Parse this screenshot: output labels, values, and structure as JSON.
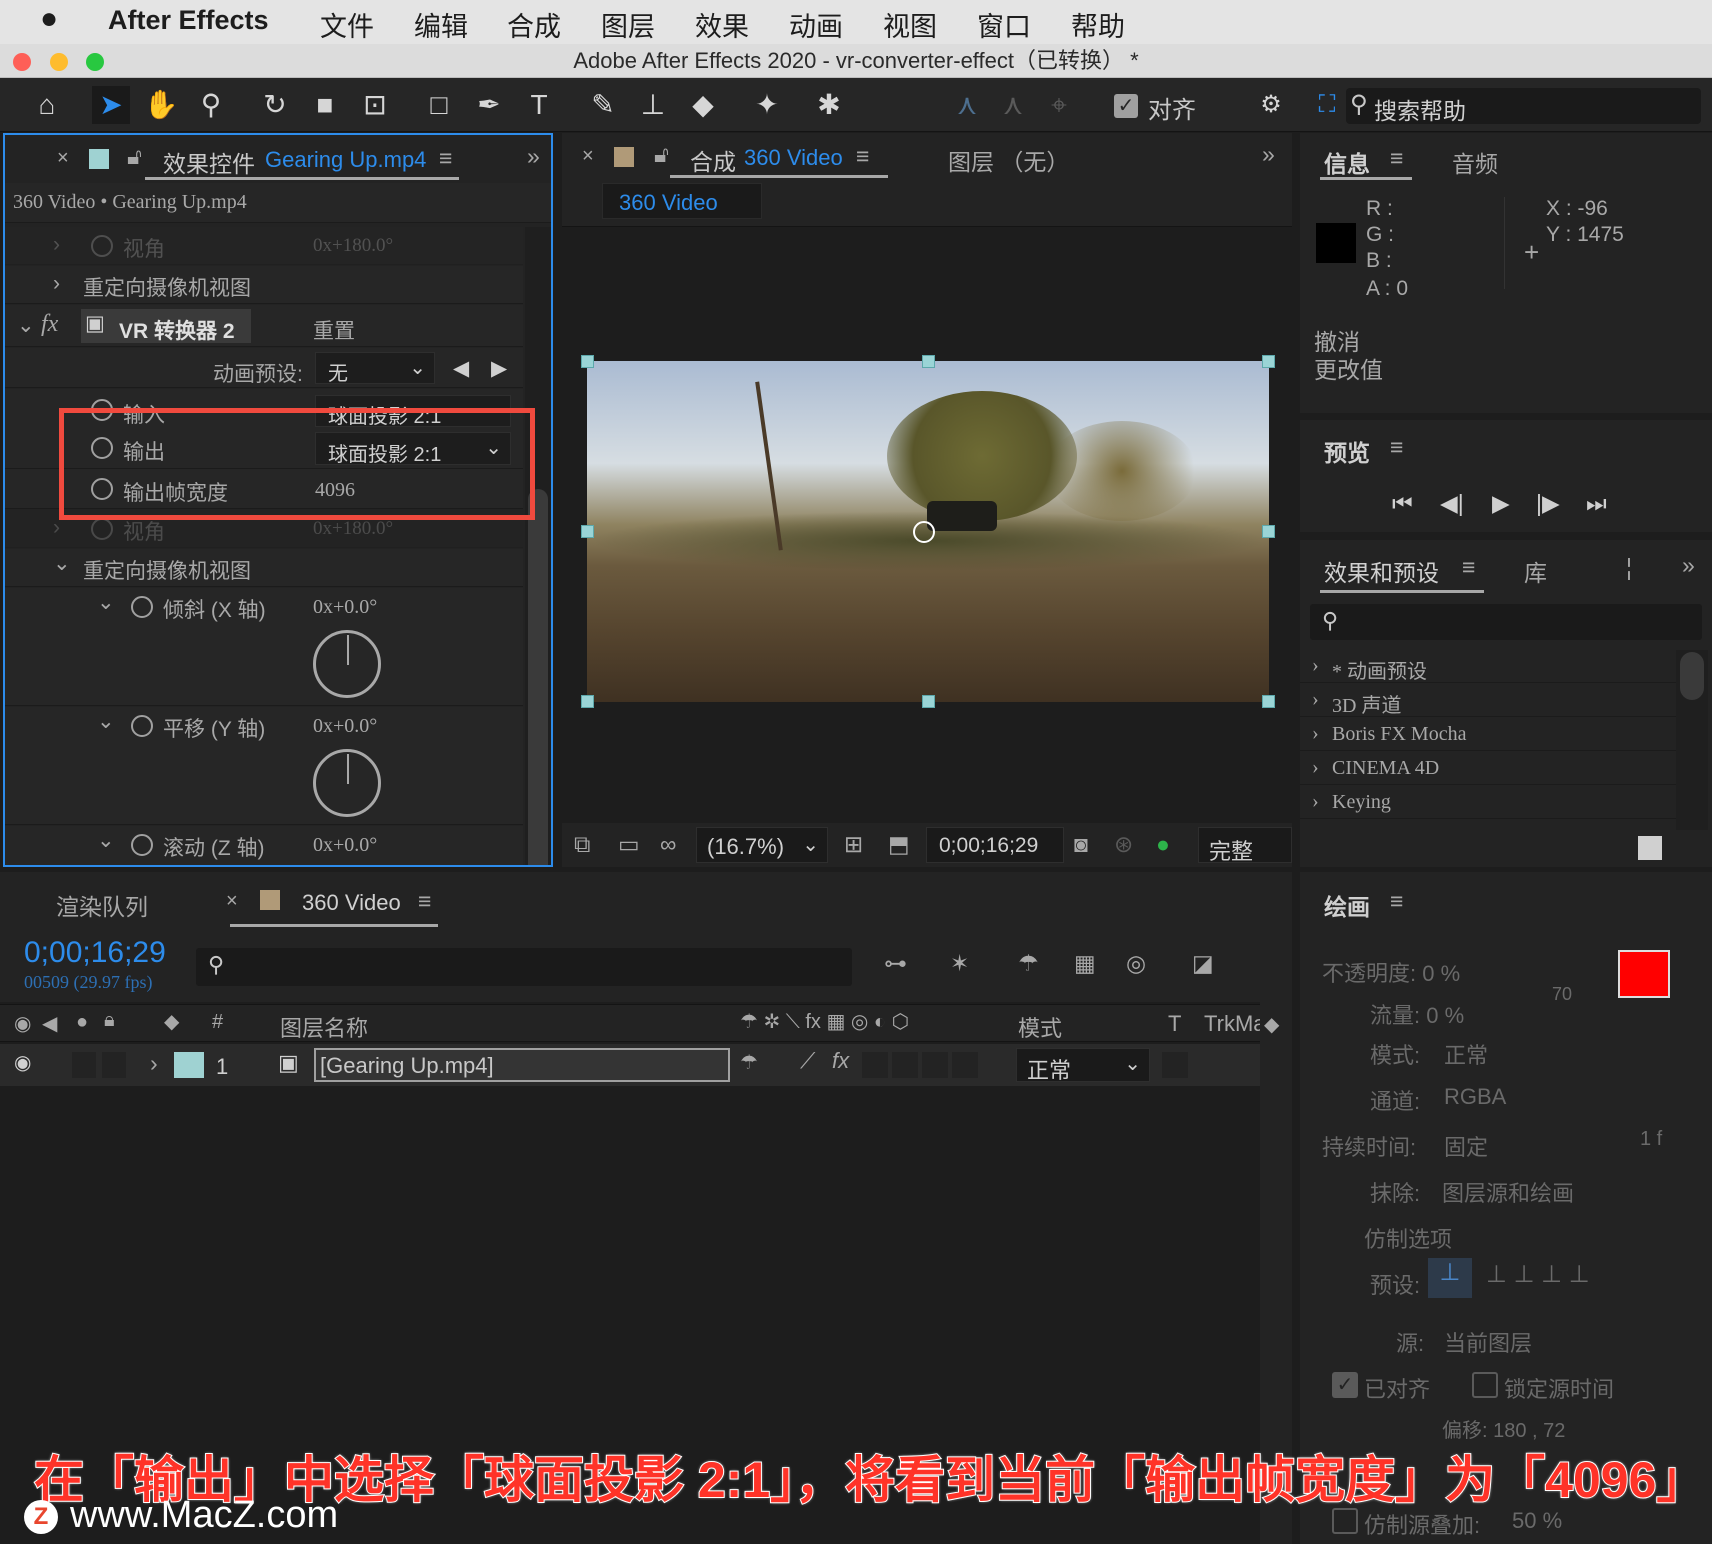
{
  "menubar": {
    "apple_icon": "apple-icon",
    "app": "After Effects",
    "items": [
      "文件",
      "编辑",
      "合成",
      "图层",
      "效果",
      "动画",
      "视图",
      "窗口",
      "帮助"
    ]
  },
  "window": {
    "title": "Adobe After Effects 2020 - vr-converter-effect（已转换）  *"
  },
  "toolbar": {
    "align_label": "对齐",
    "search_help": "搜索帮助",
    "icons": [
      "home-icon",
      "selection-tool-icon",
      "hand-tool-icon",
      "zoom-tool-icon",
      "rotate-tool-icon",
      "camera-tool-icon",
      "pan-behind-icon",
      "rectangle-tool-icon",
      "pen-tool-icon",
      "type-tool-icon",
      "brush-tool-icon",
      "clone-stamp-icon",
      "eraser-icon",
      "roto-brush-icon",
      "puppet-pin-icon"
    ]
  },
  "effects_panel": {
    "tab_label": "效果控件",
    "tab_file": "Gearing Up.mp4",
    "breadcrumb": "360 Video • Gearing Up.mp4",
    "rows": {
      "fov_top": {
        "label": "视角",
        "value": "0x+180.0°"
      },
      "reorient_top": {
        "label": "重定向摄像机视图"
      },
      "effect_name": "VR 转换器 2",
      "reset": "重置",
      "preset_label": "动画预设:",
      "preset_value": "无",
      "input_label": "输入",
      "input_value": "球面投影 2:1",
      "output_label": "输出",
      "output_value": "球面投影 2:1",
      "width_label": "输出帧宽度",
      "width_value": "4096",
      "fov2": {
        "label": "视角",
        "value": "0x+180.0°"
      },
      "reorient": {
        "label": "重定向摄像机视图"
      },
      "tilt": {
        "label": "倾斜 (X 轴)",
        "value": "0x+0.0°"
      },
      "pan": {
        "label": "平移 (Y 轴)",
        "value": "0x+0.0°"
      },
      "roll": {
        "label": "滚动 (Z 轴)",
        "value": "0x+0.0°"
      }
    },
    "highlight_color": "#f04a3e"
  },
  "comp_panel": {
    "tab_label": "合成",
    "tab_comp": "360 Video",
    "layer_tab": "图层 （无）",
    "chip": "360 Video",
    "footer": {
      "zoom": "(16.7%)",
      "timecode": "0;00;16;29",
      "quality": "完整"
    }
  },
  "info_panel": {
    "tab": "信息",
    "tab2": "音频",
    "r": "R :",
    "g": "G :",
    "b": "B :",
    "a": "A :  0",
    "x": "X : -96",
    "y": "Y : 1475",
    "undo": "撤消",
    "undo2": "更改值"
  },
  "preview_panel": {
    "tab": "预览",
    "controls": [
      "first-frame-icon",
      "prev-frame-icon",
      "play-icon",
      "next-frame-icon",
      "last-frame-icon"
    ]
  },
  "effects_presets": {
    "tab": "效果和预设",
    "tab2": "库",
    "items": [
      "* 动画预设",
      "3D 声道",
      "Boris FX Mocha",
      "CINEMA 4D",
      "Keying"
    ]
  },
  "timeline": {
    "tab_render": "渲染队列",
    "tab_comp": "360 Video",
    "timecode": "0;00;16;29",
    "frames": "00509 (29.97 fps)",
    "col_layer_name": "图层名称",
    "col_mode": "模式",
    "col_t": "T",
    "col_trkmat": "TrkMa",
    "layer": {
      "num": "1",
      "name": "[Gearing Up.mp4]",
      "mode": "正常"
    }
  },
  "paint_panel": {
    "tab": "绘画",
    "opacity": "不透明度: 0 %",
    "flow": "流量: 0 %",
    "brush_size": "70",
    "mode_label": "模式:",
    "mode_value": "正常",
    "channel_label": "通道:",
    "channel_value": "RGBA",
    "duration_label": "持续时间:",
    "duration_value": "固定",
    "duration_frames": "1  f",
    "erase_label": "抹除:",
    "erase_value": "图层源和绘画",
    "clone_options": "仿制选项",
    "preset_label": "预设:",
    "source_label": "源:",
    "source_value": "当前图层",
    "aligned": "已对齐",
    "lock_source": "锁定源时间",
    "offset": "偏移: 180 ,    72",
    "clone_overlay": "仿制源叠加:",
    "overlay_value": "50 %",
    "fg_color": "#ff0000",
    "bg_color": "#ffffff"
  },
  "caption": {
    "text": "在「输出」中选择「球面投影 2:1」，将看到当前「输出帧宽度」为「4096」",
    "watermark": "www.MacZ.com",
    "watermark_logo": "Z"
  }
}
